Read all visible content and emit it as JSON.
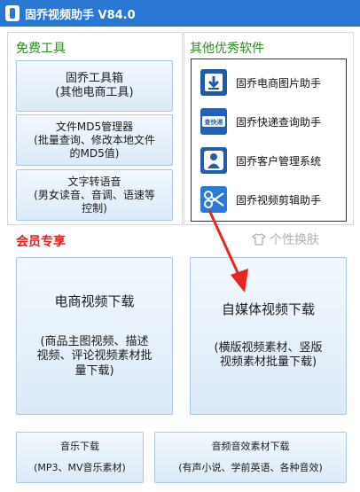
{
  "window": {
    "title": "固乔视频助手 V84.0"
  },
  "free_tools": {
    "title": "免费工具",
    "buttons": [
      {
        "lines": [
          "固乔工具箱",
          "(其他电商工具)"
        ]
      },
      {
        "lines": [
          "文件MD5管理器",
          "(批量查询、修改本地文件",
          "的MD5值)"
        ]
      },
      {
        "lines": [
          "文字转语音",
          "(男女读音、音调、语速等",
          "控制)"
        ]
      }
    ]
  },
  "other_software": {
    "title": "其他优秀软件",
    "items": [
      {
        "label": "固乔电商图片助手",
        "icon": "download-icon",
        "color": "#1d5aa8"
      },
      {
        "label": "固乔快递查询助手",
        "icon": "express-search-icon",
        "color": "#1e63b8"
      },
      {
        "label": "固乔客户管理系统",
        "icon": "customer-icon",
        "color": "#1f5fae"
      },
      {
        "label": "固乔视频剪辑助手",
        "icon": "scissors-icon",
        "color": "#2a7ad8"
      }
    ]
  },
  "vip": {
    "title": "会员专享",
    "skin_label": "个性换肤",
    "ecommerce": {
      "title": "电商视频下载",
      "desc": [
        "(商品主图视频、描述",
        "视频、评论视频素材批",
        "量下载)"
      ]
    },
    "media": {
      "title": "自媒体视频下载",
      "desc": [
        "(横版视频素材、竖版",
        "视频素材批量下载)"
      ]
    },
    "music": {
      "title": "音乐下载",
      "desc": "(MP3、MV音乐素材)"
    },
    "audio": {
      "title": "音频音效素材下载",
      "desc": "(有声小说、学前英语、各种音效)"
    }
  },
  "colors": {
    "titlebar": "#2a78d4",
    "accent_green": "#2e8b22",
    "accent_red": "#e02020",
    "arrow": "#e8251e"
  }
}
